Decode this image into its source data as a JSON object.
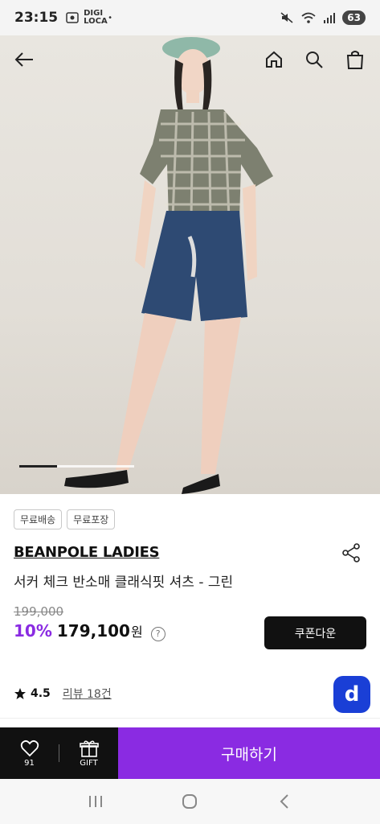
{
  "status": {
    "time": "23:15",
    "left_icons": "DIGI LOCA",
    "battery": "63"
  },
  "hero": {
    "slide_progress": 0.33
  },
  "tags": [
    "무료배송",
    "무료포장"
  ],
  "brand": "BEANPOLE LADIES",
  "product_name": "서커 체크 반소매 클래식핏 셔츠 - 그린",
  "original_price": "199,000",
  "discount": "10%",
  "price": "179,100",
  "currency": "원",
  "help_symbol": "?",
  "coupon_label": "쿠폰다운",
  "rating": "4.5",
  "review_label": "리뷰 18건",
  "badge_letter": "d",
  "wish_count": "91",
  "gift_label": "GIFT",
  "buy_label": "구매하기",
  "colors": {
    "accent": "#8a2be2",
    "dark": "#111111",
    "badge": "#1a3fd6"
  },
  "icons": [
    "back-arrow-icon",
    "home-icon",
    "search-icon",
    "bag-icon",
    "share-icon",
    "star-icon",
    "heart-icon",
    "gift-icon",
    "recents-icon",
    "home-circle-icon",
    "back-chevron-icon"
  ]
}
